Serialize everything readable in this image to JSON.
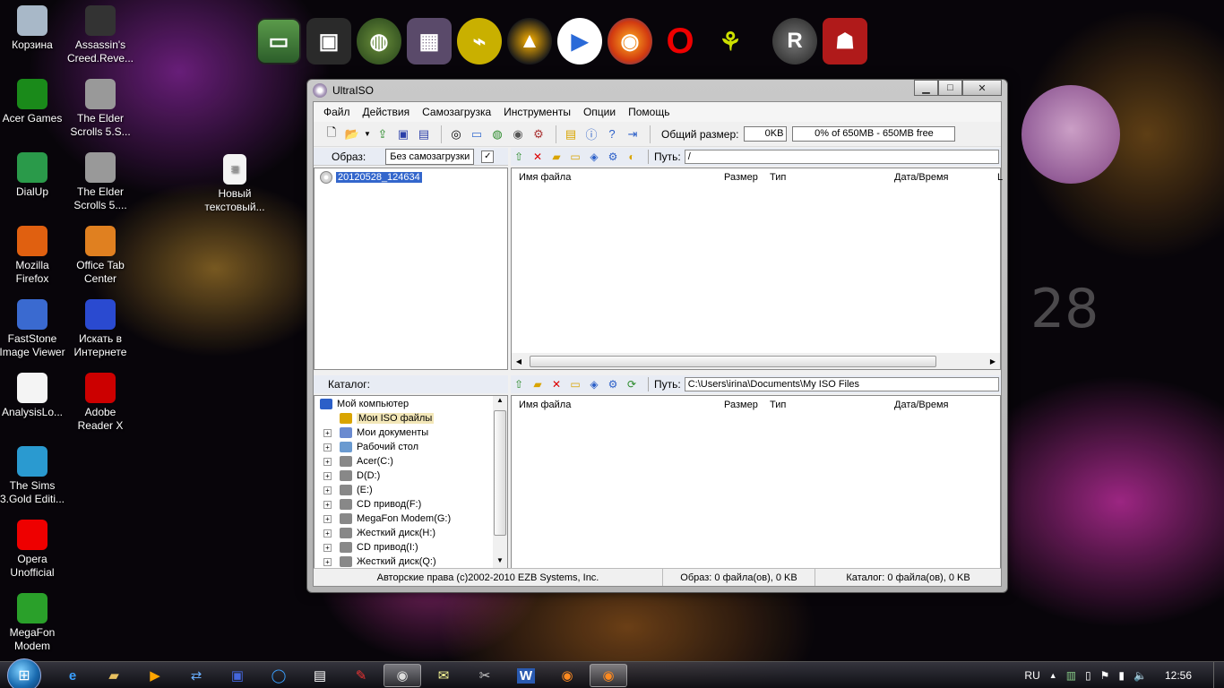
{
  "desktop": {
    "icons_col1": [
      {
        "label": "Корзина",
        "icon": "recycle-bin-icon"
      },
      {
        "label": "Acer Games",
        "icon": "acer-games-icon"
      },
      {
        "label": "DialUp",
        "icon": "dialup-icon"
      },
      {
        "label": "Mozilla Firefox",
        "icon": "firefox-icon"
      },
      {
        "label": "FastStone Image Viewer",
        "icon": "faststone-icon"
      },
      {
        "label": "AnalysisLo...",
        "icon": "document-icon"
      },
      {
        "label": "The Sims 3.Gold Editi...",
        "icon": "sims-icon"
      },
      {
        "label": "Opera Unofficial",
        "icon": "opera-icon"
      },
      {
        "label": "MegaFon Modem",
        "icon": "megafon-icon"
      }
    ],
    "icons_col2": [
      {
        "label": "Assassin's Creed.Reve...",
        "icon": "assassins-creed-icon"
      },
      {
        "label": "The Elder Scrolls 5.S...",
        "icon": "elder-scrolls-icon"
      },
      {
        "label": "The Elder Scrolls 5....",
        "icon": "elder-scrolls-icon"
      },
      {
        "label": "Office Tab Center",
        "icon": "office-tab-icon"
      },
      {
        "label": "Искать в Интернете",
        "icon": "search-web-icon"
      },
      {
        "label": "Adobe Reader X",
        "icon": "adobe-reader-icon"
      }
    ],
    "icon_col3": {
      "label": "Новый текстовый...",
      "icon": "text-file-icon"
    },
    "gadget_number": "28"
  },
  "window": {
    "title": "UltraISO",
    "menu": [
      "Файл",
      "Действия",
      "Самозагрузка",
      "Инструменты",
      "Опции",
      "Помощь"
    ],
    "total_size_label": "Общий размер:",
    "total_size_value": "0KB",
    "capacity_text": "0% of 650MB - 650MB free",
    "image_label": "Образ:",
    "boot_value": "Без самозагрузки",
    "image_tree_item": "20120528_124634",
    "path_label": "Путь:",
    "image_path": "/",
    "columns": [
      "Имя файла",
      "Размер",
      "Тип",
      "Дата/Время",
      "L"
    ],
    "catalog_label": "Каталог:",
    "catalog_path": "C:\\Users\\irina\\Documents\\My ISO Files",
    "catalog_tree": [
      "Мой компьютер",
      "Мои ISO файлы",
      "Мои документы",
      "Рабочий стол",
      "Acer(C:)",
      "D(D:)",
      "(E:)",
      "CD привод(F:)",
      "MegaFon Modem(G:)",
      "Жесткий диск(H:)",
      "CD привод(I:)",
      "Жесткий диск(Q:)"
    ],
    "status": {
      "copyright": "Авторские права (c)2002-2010 EZB Systems, Inc.",
      "image": "Образ: 0 файла(ов), 0 KB",
      "catalog": "Каталог: 0 файла(ов), 0 KB"
    }
  },
  "taskbar": {
    "lang": "RU",
    "time": "12:56"
  }
}
